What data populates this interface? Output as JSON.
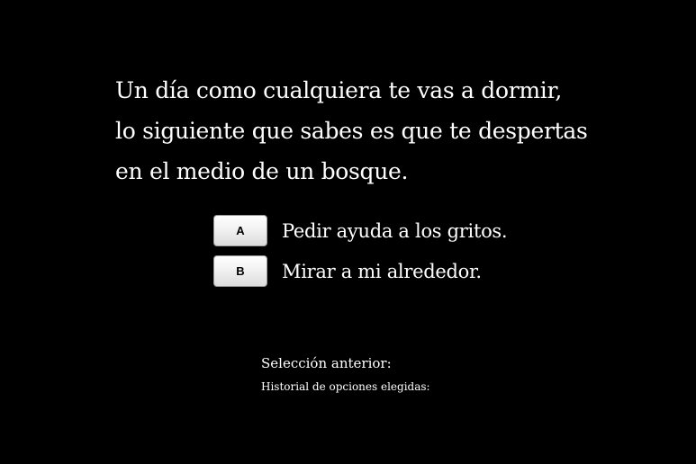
{
  "colors": {
    "background": "#000000",
    "text": "#ffffff",
    "button_face": "#f2f2f2"
  },
  "story": {
    "lines": [
      "Un día como cualquiera te vas a dormir,",
      "lo siguiente que sabes es que te despertas",
      "en el medio de un bosque."
    ]
  },
  "choices": [
    {
      "button_label": "A",
      "text": "Pedir ayuda a los gritos."
    },
    {
      "button_label": "B",
      "text": "Mirar a mi alrededor."
    }
  ],
  "info": {
    "previous_selection": "Selección anterior:",
    "history": "Historial de opciones elegidas:"
  }
}
